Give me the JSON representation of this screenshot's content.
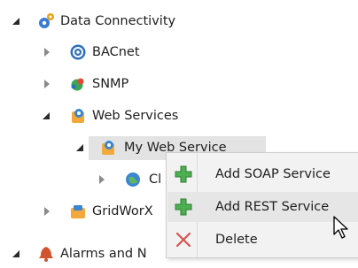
{
  "tree": {
    "data_connectivity": {
      "label": "Data Connectivity",
      "icon": "gears-icon"
    },
    "bacnet": {
      "label": "BACnet",
      "icon": "bacnet-icon"
    },
    "snmp": {
      "label": "SNMP",
      "icon": "snmp-icon"
    },
    "web_services": {
      "label": "Web Services",
      "icon": "web-services-icon"
    },
    "my_web_service": {
      "label": "My Web Service",
      "icon": "web-service-icon"
    },
    "child_c": {
      "label": "Cl",
      "icon": "globe-icon"
    },
    "gridworx": {
      "label": "GridWorX",
      "icon": "gridworx-icon"
    },
    "alarms": {
      "label": "Alarms and N",
      "icon": "alarm-icon"
    }
  },
  "context_menu": {
    "items": [
      {
        "label": "Add SOAP Service",
        "icon": "plus-icon"
      },
      {
        "label": "Add REST Service",
        "icon": "plus-icon",
        "hovered": true
      },
      {
        "label": "Delete",
        "icon": "delete-x-icon"
      }
    ]
  },
  "colors": {
    "plus_green": "#4caf50",
    "delete_red": "#d9534f",
    "hover_bg": "#e6e6e6",
    "menu_bg": "#f2f2f2"
  }
}
